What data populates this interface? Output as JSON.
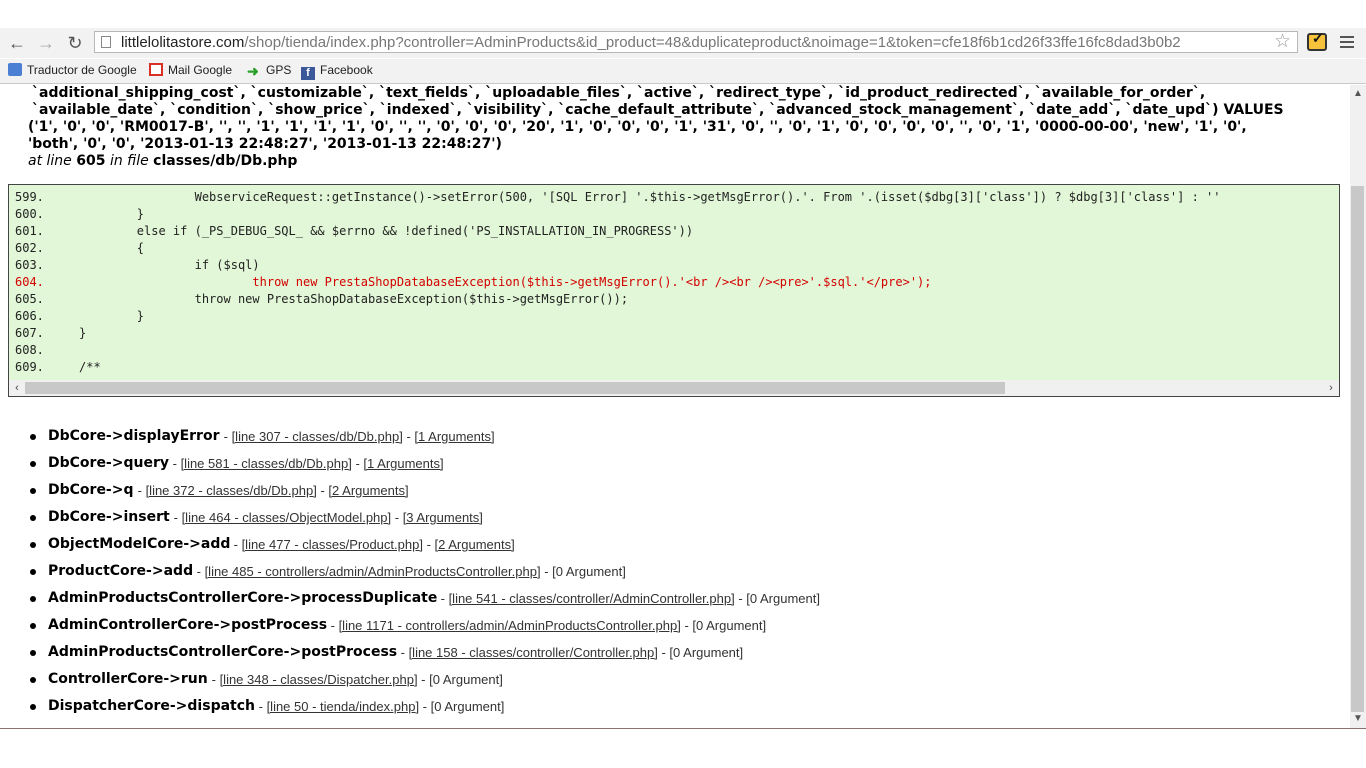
{
  "browser": {
    "url_host": "littlelolitastore.com",
    "url_path": "/shop/tienda/index.php?controller=AdminProducts&id_product=48&duplicateproduct&noimage=1&token=cfe18f6b1cd26f33ffe16fc8dad3b0b2",
    "back_icon": "back-arrow-icon",
    "forward_icon": "forward-arrow-icon",
    "reload_icon": "reload-icon",
    "star_icon": "star-icon",
    "menu_icon": "menu-icon"
  },
  "bookmarks": [
    {
      "label": "Traductor de Google",
      "icon": "google-translate-icon"
    },
    {
      "label": "Mail Google",
      "icon": "gmail-icon"
    },
    {
      "label": "GPS",
      "icon": "arrow-icon"
    },
    {
      "label": "Facebook",
      "icon": "facebook-icon"
    }
  ],
  "sql_lines": [
    "`additional_shipping_cost`, `customizable`, `text_fields`, `uploadable_files`, `active`, `redirect_type`, `id_product_redirected`, `available_for_order`,",
    "`available_date`, `condition`, `show_price`, `indexed`, `visibility`, `cache_default_attribute`, `advanced_stock_management`, `date_add`, `date_upd`) VALUES",
    "('1', '0', '0', 'RM0017-B', '', '', '1', '1', '1', '1', '0', '', '', '0', '0', '0', '20', '1', '0', '0', '0', '1', '31', '0', '', '0', '1', '0', '0', '0', '0', '', '0', '1', '0000-00-00', 'new', '1', '0',",
    "'both', '0', '0', '2013-01-13 22:48:27', '2013-01-13 22:48:27')"
  ],
  "error_location": {
    "prefix": "at line",
    "line": "605",
    "mid": "in file",
    "file": "classes/db/Db.php"
  },
  "code": [
    {
      "num": "599.",
      "text": "                WebserviceRequest::getInstance()->setError(500, '[SQL Error] '.$this->getMsgError().'. From '.(isset($dbg[3]['class']) ? $dbg[3]['class'] : ''"
    },
    {
      "num": "600.",
      "text": "        }"
    },
    {
      "num": "601.",
      "text": "        else if (_PS_DEBUG_SQL_ && $errno && !defined('PS_INSTALLATION_IN_PROGRESS'))"
    },
    {
      "num": "602.",
      "text": "        {"
    },
    {
      "num": "603.",
      "text": "                if ($sql)"
    },
    {
      "num": "604.",
      "text": "                        throw new PrestaShopDatabaseException($this->getMsgError().'<br /><br /><pre>'.$sql.'</pre>');"
    },
    {
      "num": "605.",
      "text": "                throw new PrestaShopDatabaseException($this->getMsgError());"
    },
    {
      "num": "606.",
      "text": "        }"
    },
    {
      "num": "607.",
      "text": "}"
    },
    {
      "num": "608.",
      "text": ""
    },
    {
      "num": "609.",
      "text": "/**"
    }
  ],
  "highlight_line": "604.",
  "trace": [
    {
      "fn": "DbCore->displayError",
      "sep1": " - ",
      "loc": "[line 307 - classes/db/Db.php]",
      "sep2": " - ",
      "args": "[1 Arguments]",
      "args_link": true
    },
    {
      "fn": "DbCore->query",
      "sep1": " - ",
      "loc": "[line 581 - classes/db/Db.php]",
      "sep2": " - ",
      "args": "[1 Arguments]",
      "args_link": true
    },
    {
      "fn": "DbCore->q",
      "sep1": " - ",
      "loc": "[line 372 - classes/db/Db.php]",
      "sep2": " - ",
      "args": "[2 Arguments]",
      "args_link": true
    },
    {
      "fn": "DbCore->insert",
      "sep1": " - ",
      "loc": "[line 464 - classes/ObjectModel.php]",
      "sep2": " - ",
      "args": "[3 Arguments]",
      "args_link": true
    },
    {
      "fn": "ObjectModelCore->add",
      "sep1": " - ",
      "loc": "[line 477 - classes/Product.php]",
      "sep2": " - ",
      "args": "[2 Arguments]",
      "args_link": true
    },
    {
      "fn": "ProductCore->add",
      "sep1": " - ",
      "loc": "[line 485 - controllers/admin/AdminProductsController.php]",
      "sep2": " - ",
      "args": "[0 Argument]",
      "args_link": false
    },
    {
      "fn": "AdminProductsControllerCore->processDuplicate",
      "sep1": " - ",
      "loc": "[line 541 - classes/controller/AdminController.php]",
      "sep2": " - ",
      "args": "[0 Argument]",
      "args_link": false
    },
    {
      "fn": "AdminControllerCore->postProcess",
      "sep1": " - ",
      "loc": "[line 1171 - controllers/admin/AdminProductsController.php]",
      "sep2": " - ",
      "args": "[0 Argument]",
      "args_link": false
    },
    {
      "fn": "AdminProductsControllerCore->postProcess",
      "sep1": " - ",
      "loc": "[line 158 - classes/controller/Controller.php]",
      "sep2": " - ",
      "args": "[0 Argument]",
      "args_link": false
    },
    {
      "fn": "ControllerCore->run",
      "sep1": " - ",
      "loc": "[line 348 - classes/Dispatcher.php]",
      "sep2": " - ",
      "args": "[0 Argument]",
      "args_link": false
    },
    {
      "fn": "DispatcherCore->dispatch",
      "sep1": " - ",
      "loc": "[line 50 - tienda/index.php]",
      "sep2": " - ",
      "args": "[0 Argument]",
      "args_link": false
    }
  ]
}
